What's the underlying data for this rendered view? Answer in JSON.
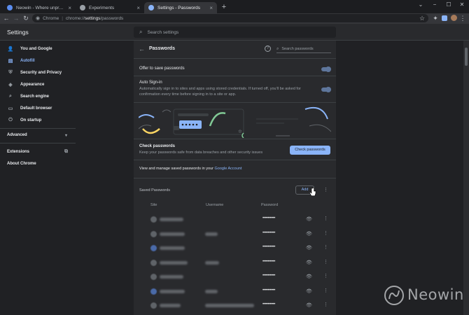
{
  "tabs": [
    {
      "label": "Neowin - Where unprofessional...",
      "favicon_color": "#5b8def",
      "close": "×"
    },
    {
      "label": "Experiments",
      "favicon_color": "#9aa0a6",
      "close": "×"
    },
    {
      "label": "Settings - Passwords",
      "favicon_color": "#8ab4f8",
      "close": "×"
    }
  ],
  "new_tab": "+",
  "window_controls": {
    "dropdown": "⌄",
    "minimize": "−",
    "maximize": "☐",
    "close": "✕"
  },
  "toolbar": {
    "back": "←",
    "forward": "→",
    "reload": "↻",
    "site_label": "Chrome",
    "url_scheme": "chrome://",
    "url_host": "settings",
    "url_path": "/passwords",
    "star": "☆",
    "puzzle": "✦",
    "menu": "⋮"
  },
  "settings": {
    "title": "Settings",
    "search_placeholder": "Search settings"
  },
  "sidebar": {
    "items": [
      {
        "label": "You and Google",
        "icon": "person-icon",
        "glyph": "👤"
      },
      {
        "label": "Autofill",
        "icon": "autofill-icon",
        "glyph": "▤"
      },
      {
        "label": "Security and Privacy",
        "icon": "shield-icon",
        "glyph": "⛨"
      },
      {
        "label": "Appearance",
        "icon": "palette-icon",
        "glyph": "◈"
      },
      {
        "label": "Search engine",
        "icon": "search-icon",
        "glyph": "⌕"
      },
      {
        "label": "Default browser",
        "icon": "browser-icon",
        "glyph": "▭"
      },
      {
        "label": "On startup",
        "icon": "power-icon",
        "glyph": "⏻"
      }
    ],
    "advanced": "Advanced",
    "extensions": "Extensions",
    "about": "About Chrome"
  },
  "passwords": {
    "title": "Passwords",
    "search_placeholder": "Search passwords",
    "offer_label": "Offer to save passwords",
    "auto_signin_label": "Auto Sign-in",
    "auto_signin_desc_1": "Automatically sign in to sites and apps using stored credentials. If turned off, you'll be asked for",
    "auto_signin_desc_2": "confirmation every time before signing in to a site or app.",
    "check_title": "Check passwords",
    "check_desc": "Keep your passwords safe from data breaches and other security issues",
    "check_button": "Check passwords",
    "manage_text": "View and manage saved passwords in your ",
    "manage_link": "Google Account",
    "saved_title": "Saved Passwords",
    "add_button": "Add",
    "col_site": "Site",
    "col_username": "Username",
    "col_password": "Password",
    "password_mask": "••••••••••",
    "rows": [
      {
        "fav": "gray",
        "site_w": 34,
        "user_w": 0
      },
      {
        "fav": "gray",
        "site_w": 36,
        "user_w": 18
      },
      {
        "fav": "blue",
        "site_w": 36,
        "user_w": 0
      },
      {
        "fav": "gray",
        "site_w": 40,
        "user_w": 20
      },
      {
        "fav": "gray",
        "site_w": 34,
        "user_w": 0
      },
      {
        "fav": "blue",
        "site_w": 36,
        "user_w": 18
      },
      {
        "fav": "gray",
        "site_w": 30,
        "user_w": 70
      }
    ]
  },
  "watermark": "Neowin",
  "colors": {
    "accent": "#8ab4f8",
    "bg": "#202124",
    "card": "#292a2d"
  }
}
